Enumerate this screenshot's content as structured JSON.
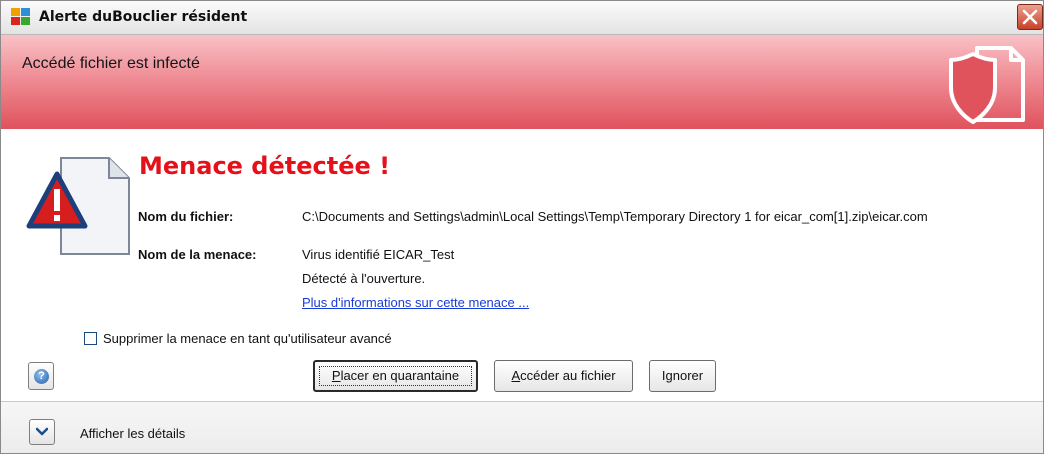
{
  "window": {
    "title": "Alerte duBouclier résident",
    "colors": {
      "banner": "#e0525c",
      "heading": "#e4101a",
      "link": "#1a3cd6"
    }
  },
  "banner": {
    "title": "Accédé fichier est infecté",
    "icon": "shield-document-icon"
  },
  "alert": {
    "heading": "Menace détectée !",
    "icon": "warning-document-icon",
    "file_label": "Nom du fichier:",
    "file_value": "C:\\Documents and Settings\\admin\\Local Settings\\Temp\\Temporary Directory 1 for eicar_com[1].zip\\eicar.com",
    "threat_label": "Nom de la menace:",
    "threat_value": "Virus identifié EICAR_Test",
    "detected_when": "Détecté à l'ouverture.",
    "more_info_link": "Plus d'informations sur cette menace ..."
  },
  "options": {
    "advanced_delete_label": "Supprimer la menace en tant qu'utilisateur avancé",
    "advanced_delete_checked": false
  },
  "buttons": {
    "help_icon": "help-icon",
    "quarantine_first": "P",
    "quarantine_rest": "lacer en quarantaine",
    "open_file_first": "A",
    "open_file_rest": "ccéder au fichier",
    "ignore": "Ignorer"
  },
  "footer": {
    "details_label": "Afficher les détails",
    "expand_icon": "chevron-down-icon"
  }
}
